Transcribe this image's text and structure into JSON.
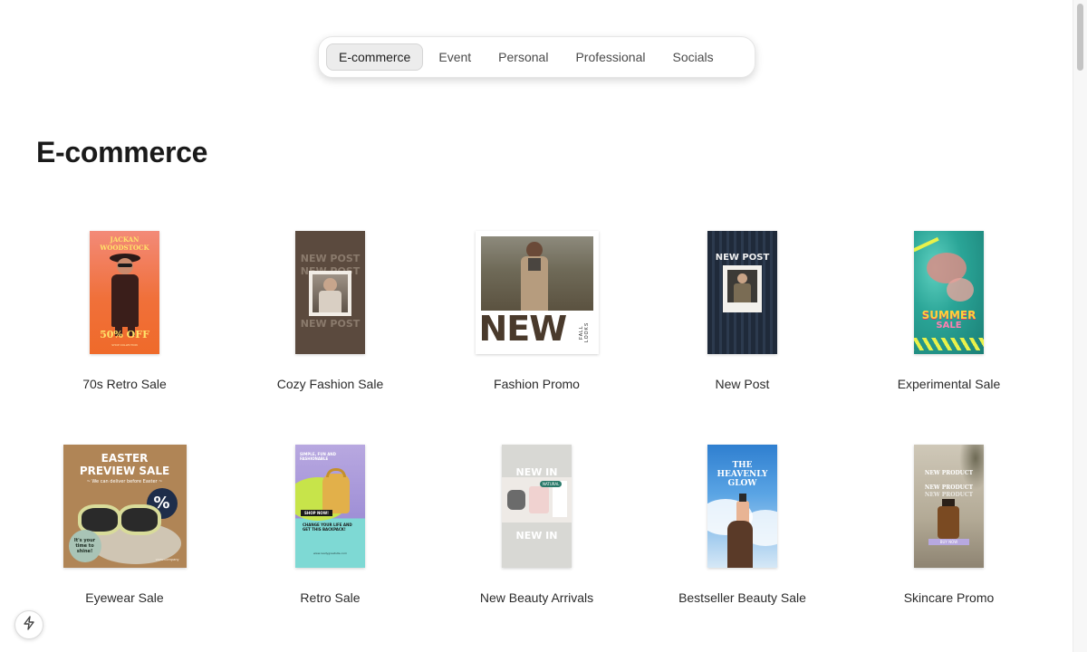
{
  "tabs": [
    {
      "label": "E-commerce",
      "active": true
    },
    {
      "label": "Event",
      "active": false
    },
    {
      "label": "Personal",
      "active": false
    },
    {
      "label": "Professional",
      "active": false
    },
    {
      "label": "Socials",
      "active": false
    }
  ],
  "section": {
    "title": "E-commerce"
  },
  "templates": [
    {
      "title": "70s Retro Sale",
      "art": {
        "line1": "JACKAN",
        "line2": "WOODSTOCK",
        "promo": "50% OFF",
        "footer": "SHOP COLLECTION"
      }
    },
    {
      "title": "Cozy Fashion Sale",
      "art": {
        "headline": "NEW POST"
      }
    },
    {
      "title": "Fashion Promo",
      "art": {
        "headline": "NEW",
        "side_text": "FALL LOOKS"
      }
    },
    {
      "title": "New Post",
      "art": {
        "headline": "NEW POST"
      }
    },
    {
      "title": "Experimental Sale",
      "art": {
        "line1": "SUMMER",
        "line2": "SALE"
      }
    },
    {
      "title": "Eyewear Sale",
      "art": {
        "headline": "EASTER PREVIEW SALE",
        "subhead": "~ We can deliver before Easter ~",
        "badge": "%",
        "bubble": "It's your time to shine!",
        "footer": "www.company"
      }
    },
    {
      "title": "Retro Sale",
      "art": {
        "top_text": "SIMPLE, FUN AND FASHIONABLE",
        "cta": "SHOP NOW!",
        "body": "CHANGE YOUR LIFE AND GET THIS BACKPACK!",
        "footer": "www.reallygreatsite.com"
      }
    },
    {
      "title": "New Beauty Arrivals",
      "art": {
        "headline": "NEW IN",
        "headline2": "NEW IN",
        "label": "NATURAL"
      }
    },
    {
      "title": "Bestseller Beauty Sale",
      "art": {
        "line1": "THE",
        "line2": "HEAVENLY",
        "line3": "GLOW"
      }
    },
    {
      "title": "Skincare Promo",
      "art": {
        "line1": "NEW PRODUCT",
        "line2": "NEW PRODUCT",
        "line3": "NEW PRODUCT",
        "label": "BUY NOW"
      }
    }
  ],
  "floating": {
    "icon": "bolt-icon"
  }
}
